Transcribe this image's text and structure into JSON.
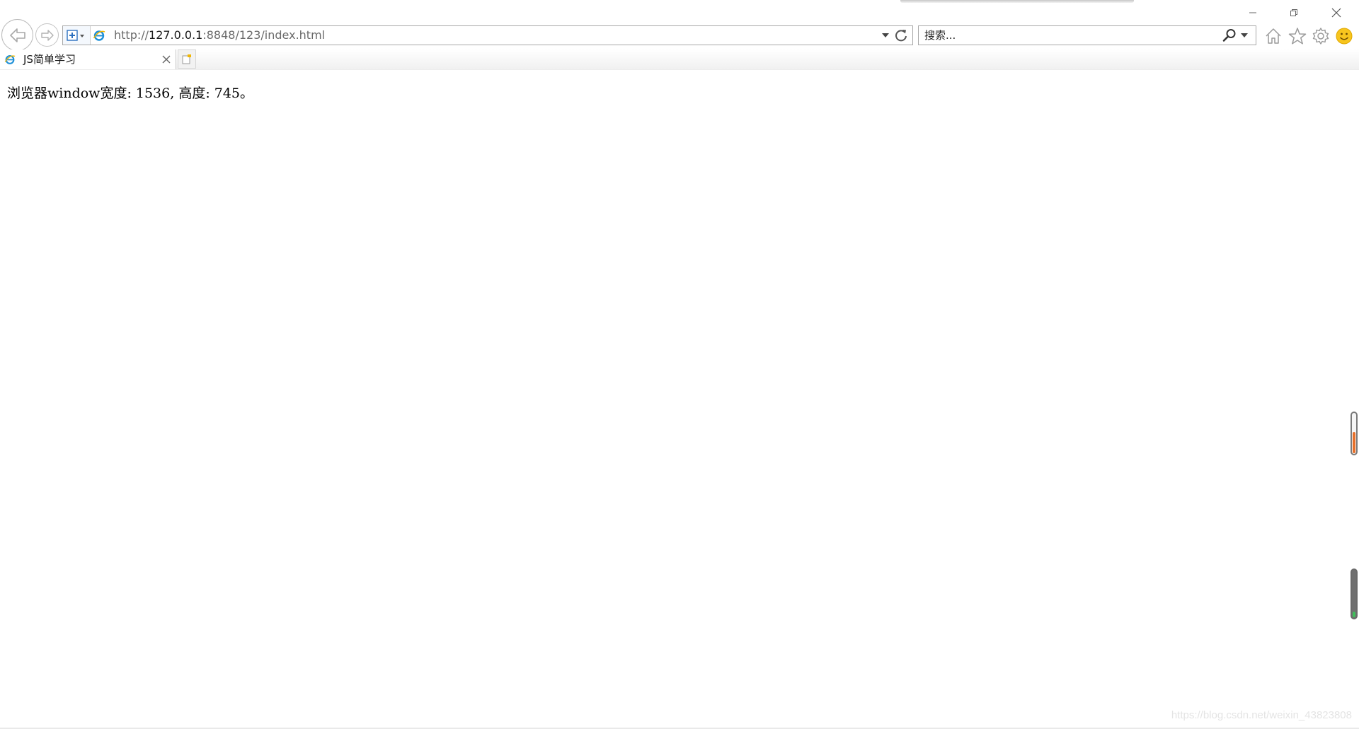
{
  "browser": {
    "address": {
      "url_prefix": "http://",
      "url_host": "127.0.0.1",
      "url_rest": ":8848/123/index.html"
    },
    "search": {
      "placeholder": "搜索..."
    },
    "tab": {
      "label": "JS简单学习"
    },
    "icons": {
      "back": "back-arrow-icon",
      "forward": "forward-arrow-icon",
      "compat": "compatibility-view-icon",
      "page": "ie-page-icon",
      "refresh": "refresh-icon",
      "search": "search-icon",
      "home": "home-icon",
      "favorites": "star-icon",
      "tools": "gear-icon",
      "feedback": "smiley-icon",
      "close_tab": "close-icon",
      "new_tab": "new-tab-icon"
    }
  },
  "page": {
    "text": "浏览器window宽度: 1536, 高度: 745。"
  },
  "watermark": "https://blog.csdn.net/weixin_43823808",
  "colors": {
    "accent_ie": "#1e90d8",
    "gauge_top_fill": "#e8702a",
    "gauge_bottom_fill": "#3fbf5a"
  }
}
